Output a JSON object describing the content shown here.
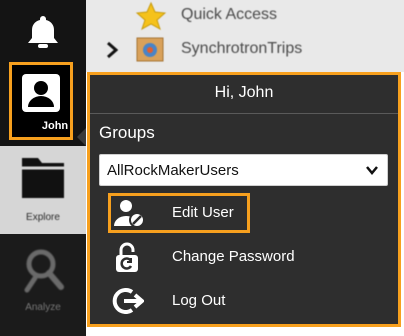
{
  "rail": {
    "bell_icon": "bell-icon",
    "user_label": "John",
    "explore_label": "Explore",
    "analyze_label": "Analyze"
  },
  "tree": {
    "items": [
      {
        "label": "Quick Access",
        "icon": "star-icon"
      },
      {
        "label": "SynchrotronTrips",
        "icon": "synchrotron-folder-icon"
      }
    ]
  },
  "popover": {
    "greeting": "Hi, John",
    "groups_label": "Groups",
    "groups_selected": "AllRockMakerUsers",
    "menu": [
      {
        "label": "Edit User",
        "icon": "edit-user-icon"
      },
      {
        "label": "Change Password",
        "icon": "lock-icon"
      },
      {
        "label": "Log Out",
        "icon": "logout-icon"
      }
    ]
  },
  "colors": {
    "highlight": "#f7a01e",
    "panel": "#2e2e2e",
    "rail": "#141414"
  }
}
